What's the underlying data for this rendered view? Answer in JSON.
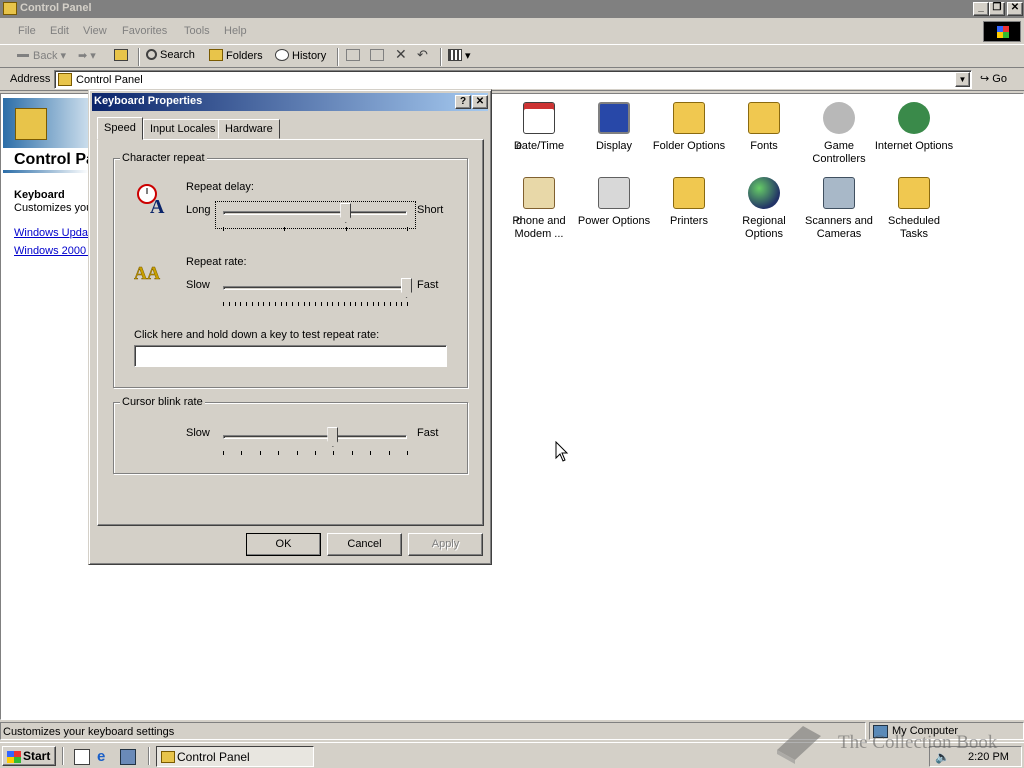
{
  "window": {
    "title": "Control Panel"
  },
  "menu": [
    "File",
    "Edit",
    "View",
    "Favorites",
    "Tools",
    "Help"
  ],
  "toolbar": {
    "back": "Back",
    "search": "Search",
    "folders": "Folders",
    "history": "History"
  },
  "address": {
    "label": "Address",
    "value": "Control Panel",
    "go": "Go"
  },
  "left_pane": {
    "title": "Control Panel",
    "selected_name": "Keyboard",
    "selected_desc": "Customizes your keyboard settings",
    "links": [
      "Windows Update",
      "Windows 2000 Support"
    ]
  },
  "icons_row1": [
    "e",
    "Date/Time",
    "Display",
    "Folder Options",
    "Fonts",
    "Game Controllers",
    "Internet Options"
  ],
  "icons_row2": [
    "d\n.",
    "Phone and Modem ...",
    "Power Options",
    "Printers",
    "Regional Options",
    "Scanners and Cameras",
    "Scheduled Tasks"
  ],
  "status": {
    "text": "Customizes your keyboard settings",
    "zone": "My Computer"
  },
  "taskbar": {
    "start": "Start",
    "task": "Control Panel",
    "clock": "2:20 PM"
  },
  "watermark": "The Collection Book",
  "dialog": {
    "title": "Keyboard Properties",
    "tabs": [
      "Speed",
      "Input Locales",
      "Hardware"
    ],
    "active_tab": "Speed",
    "group_repeat": "Character repeat",
    "repeat_delay_label": "Repeat delay:",
    "repeat_delay_min": "Long",
    "repeat_delay_max": "Short",
    "repeat_delay_value": 0.67,
    "repeat_rate_label": "Repeat rate:",
    "repeat_rate_min": "Slow",
    "repeat_rate_max": "Fast",
    "repeat_rate_value": 1.0,
    "test_label": "Click here and hold down a key to test repeat rate:",
    "test_value": "",
    "group_blink": "Cursor blink rate",
    "blink_min": "Slow",
    "blink_max": "Fast",
    "blink_value": 0.6,
    "buttons": {
      "ok": "OK",
      "cancel": "Cancel",
      "apply": "Apply"
    }
  }
}
